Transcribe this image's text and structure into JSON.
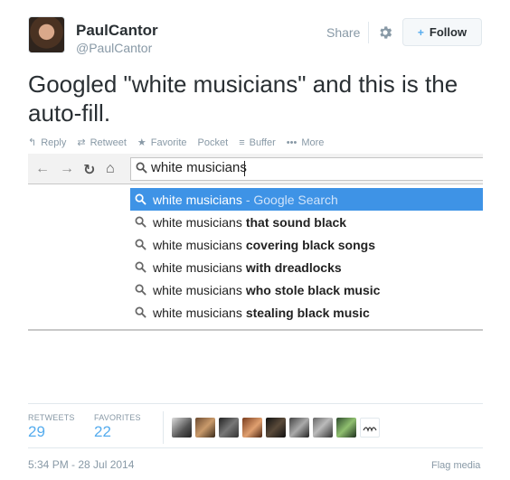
{
  "header": {
    "display_name": "PaulCantor",
    "screen_name": "@PaulCantor",
    "share_label": "Share",
    "follow_label": "Follow",
    "follow_icon": "+"
  },
  "tweet": {
    "text_line1": "Googled \"white musicians\" and this is the",
    "text_line2": "auto-fill."
  },
  "actions": {
    "reply": "Reply",
    "retweet": "Retweet",
    "favorite": "Favorite",
    "pocket": "Pocket",
    "buffer": "Buffer",
    "more": "More"
  },
  "screenshot": {
    "omnibox_text": "white musicians",
    "suggestions": [
      {
        "query": "white musicians",
        "suffix": "- Google Search",
        "selected": true
      },
      {
        "query": "white musicians",
        "bold": "that sound black"
      },
      {
        "query": "white musicians",
        "bold": "covering black songs"
      },
      {
        "query": "white musicians",
        "bold": "with dreadlocks"
      },
      {
        "query": "white musicians",
        "bold": "who stole black music"
      },
      {
        "query": "white musicians",
        "bold": "stealing black music"
      }
    ]
  },
  "stats": {
    "retweets_label": "RETWEETS",
    "retweets_count": "29",
    "favorites_label": "FAVORITES",
    "favorites_count": "22"
  },
  "footer": {
    "timestamp": "5:34 PM - 28 Jul 2014",
    "flag_label": "Flag media"
  },
  "colors": {
    "accent": "#55acee",
    "selected_suggestion": "#3e93e6",
    "muted_text": "#8899a6"
  }
}
